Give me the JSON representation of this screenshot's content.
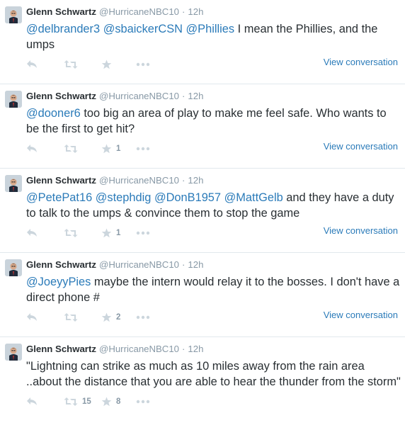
{
  "tweets": [
    {
      "name": "Glenn Schwartz",
      "handle": "@HurricaneNBC10",
      "separator": "·",
      "time": "12h",
      "text_parts": [
        {
          "t": "@delbrander3",
          "m": true
        },
        {
          "t": " ",
          "m": false
        },
        {
          "t": "@sbaickerCSN",
          "m": true
        },
        {
          "t": " ",
          "m": false
        },
        {
          "t": "@Phillies",
          "m": true
        },
        {
          "t": " I mean the Phillies, and the umps",
          "m": false
        }
      ],
      "retweets": "",
      "favorites": "",
      "view_conversation": "View conversation"
    },
    {
      "name": "Glenn Schwartz",
      "handle": "@HurricaneNBC10",
      "separator": "·",
      "time": "12h",
      "text_parts": [
        {
          "t": "@dooner6",
          "m": true
        },
        {
          "t": " too big an area of play to make me feel safe. Who wants to be the first to get hit?",
          "m": false
        }
      ],
      "retweets": "",
      "favorites": "1",
      "view_conversation": "View conversation"
    },
    {
      "name": "Glenn Schwartz",
      "handle": "@HurricaneNBC10",
      "separator": "·",
      "time": "12h",
      "text_parts": [
        {
          "t": "@PetePat16",
          "m": true
        },
        {
          "t": " ",
          "m": false
        },
        {
          "t": "@stephdig",
          "m": true
        },
        {
          "t": " ",
          "m": false
        },
        {
          "t": "@DonB1957",
          "m": true
        },
        {
          "t": " ",
          "m": false
        },
        {
          "t": "@MattGelb",
          "m": true
        },
        {
          "t": " and they have a duty to talk to the umps & convince them to stop the game",
          "m": false
        }
      ],
      "retweets": "",
      "favorites": "1",
      "view_conversation": "View conversation"
    },
    {
      "name": "Glenn Schwartz",
      "handle": "@HurricaneNBC10",
      "separator": "·",
      "time": "12h",
      "text_parts": [
        {
          "t": "@JoeyyPies",
          "m": true
        },
        {
          "t": " maybe the intern would relay it to the bosses. I don't have a direct phone #",
          "m": false
        }
      ],
      "retweets": "",
      "favorites": "2",
      "view_conversation": "View conversation"
    },
    {
      "name": "Glenn Schwartz",
      "handle": "@HurricaneNBC10",
      "separator": "·",
      "time": "12h",
      "text_parts": [
        {
          "t": "\"Lightning can strike as much as 10 miles away from the rain area ..about the distance that you are able to hear the thunder from the storm\"",
          "m": false
        }
      ],
      "retweets": "15",
      "favorites": "8",
      "view_conversation": ""
    }
  ],
  "icons": {
    "reply": "reply-icon",
    "retweet": "retweet-icon",
    "favorite": "star-icon",
    "more": "more-icon",
    "avatar": "avatar-photo"
  },
  "colors": {
    "link": "#2b7bb9",
    "muted": "#8899a6",
    "icon": "#ccd6dd",
    "divider": "#e1e8ed"
  }
}
